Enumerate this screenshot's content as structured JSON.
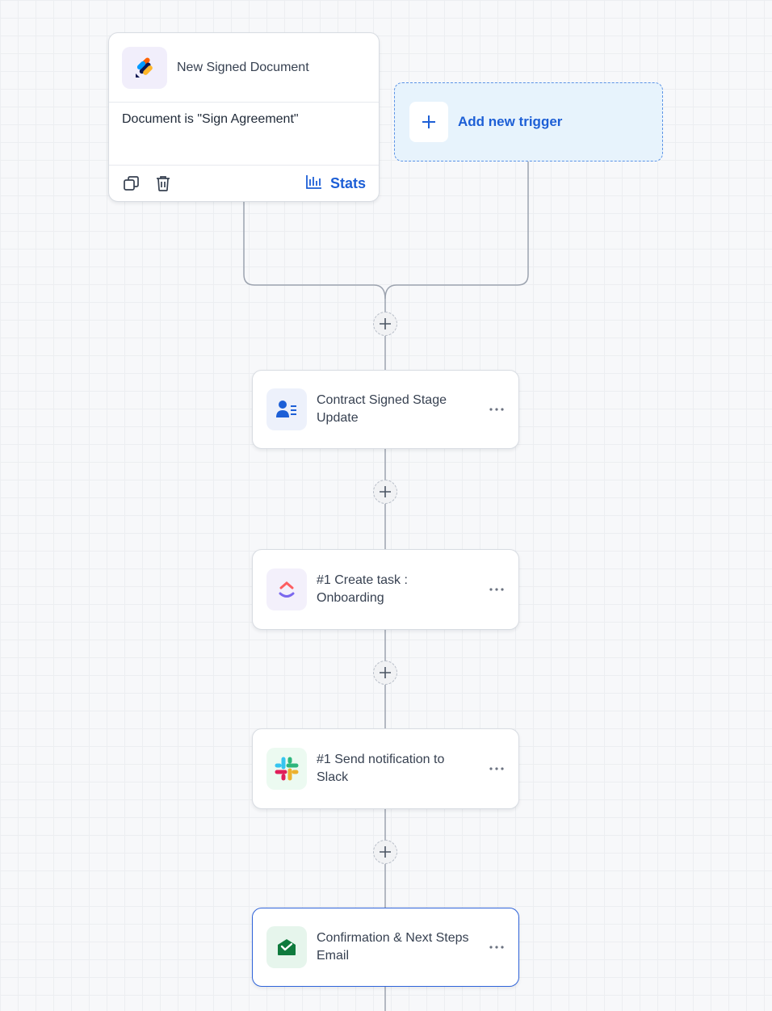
{
  "trigger": {
    "app_icon": "jotform-sign-icon",
    "title": "New Signed Document",
    "condition": "Document is \"Sign Agreement\"",
    "copy_icon": "copy-icon",
    "delete_icon": "trash-icon",
    "stats_label": "Stats",
    "stats_icon": "bar-chart-icon"
  },
  "add_trigger": {
    "label": "Add new trigger",
    "icon": "plus-icon"
  },
  "steps": [
    {
      "title": "Contract Signed Stage Update",
      "icon": "contact-card-icon",
      "more_icon": "ellipsis-icon"
    },
    {
      "title": "#1 Create task : Onboarding",
      "icon": "clickup-icon",
      "more_icon": "ellipsis-icon"
    },
    {
      "title": "#1 Send notification to Slack",
      "icon": "slack-icon",
      "more_icon": "ellipsis-icon"
    },
    {
      "title": "Confirmation & Next Steps Email",
      "icon": "email-open-icon",
      "more_icon": "ellipsis-icon",
      "selected": true
    }
  ],
  "colors": {
    "accent": "#1d5fd6",
    "selected_border": "#2e63d9",
    "add_trigger_bg": "#e7f3fc",
    "canvas_bg": "#f7f8fa"
  }
}
